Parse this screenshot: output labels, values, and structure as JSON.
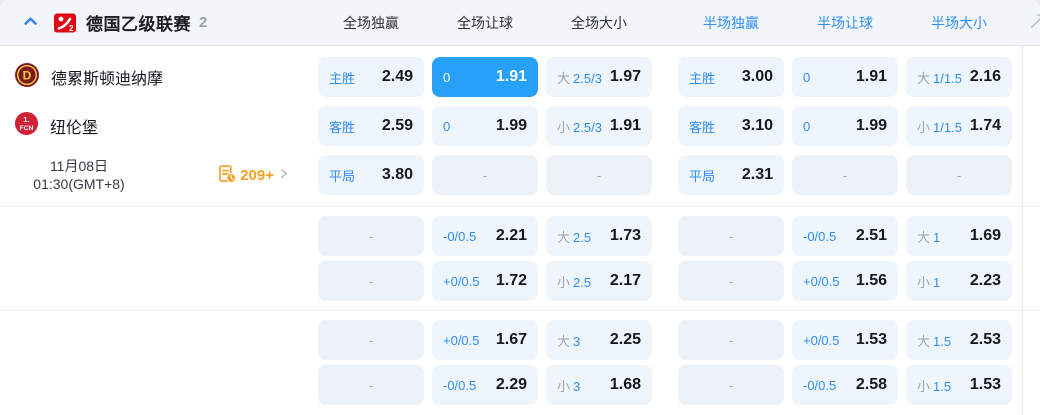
{
  "header": {
    "collapse_icon": "chevron-up-icon",
    "league_icon": "bundesliga-2-logo",
    "league": "德国乙级联赛",
    "count": "2",
    "columns": [
      {
        "label": "全场独赢",
        "active": false
      },
      {
        "label": "全场让球",
        "active": false
      },
      {
        "label": "全场大小",
        "active": false
      },
      {
        "label": "半场独赢",
        "active": true
      },
      {
        "label": "半场让球",
        "active": true
      },
      {
        "label": "半场大小",
        "active": true
      }
    ]
  },
  "match": {
    "home_team": "德累斯顿迪纳摩",
    "home_logo_icon": "dynamo-dresden-crest",
    "away_team": "纽伦堡",
    "away_logo_icon": "nuernberg-crest",
    "date": "11月08日",
    "time": "01:30(GMT+8)",
    "more_markets_count": "209+",
    "more_markets_icon": "list-clock-icon",
    "more_arrow_icon": "chevron-right-icon"
  },
  "empty_placeholder": "-",
  "colors": {
    "accent_blue": "#2f8ef4",
    "selected_cell_bg": "#27a0f7",
    "cell_bg": "#eef5fc",
    "orange": "#f6a021"
  },
  "odds_groups": [
    {
      "rows": [
        [
          {
            "t": "win",
            "label": "主胜",
            "value": "2.49"
          },
          {
            "t": "hcp",
            "label": "0",
            "value": "1.91",
            "selected": true
          },
          {
            "t": "ou",
            "side": "大",
            "line": "2.5/3",
            "value": "1.97"
          },
          {
            "t": "win",
            "label": "主胜",
            "value": "3.00"
          },
          {
            "t": "hcp",
            "label": "0",
            "value": "1.91"
          },
          {
            "t": "ou",
            "side": "大",
            "line": "1/1.5",
            "value": "2.16"
          }
        ],
        [
          {
            "t": "win",
            "label": "客胜",
            "value": "2.59"
          },
          {
            "t": "hcp",
            "label": "0",
            "value": "1.99"
          },
          {
            "t": "ou",
            "side": "小",
            "line": "2.5/3",
            "value": "1.91"
          },
          {
            "t": "win",
            "label": "客胜",
            "value": "3.10"
          },
          {
            "t": "hcp",
            "label": "0",
            "value": "1.99"
          },
          {
            "t": "ou",
            "side": "小",
            "line": "1/1.5",
            "value": "1.74"
          }
        ],
        [
          {
            "t": "win",
            "label": "平局",
            "value": "3.80"
          },
          {
            "t": "empty"
          },
          {
            "t": "empty"
          },
          {
            "t": "win",
            "label": "平局",
            "value": "2.31"
          },
          {
            "t": "empty"
          },
          {
            "t": "empty"
          }
        ]
      ]
    },
    {
      "rows": [
        [
          {
            "t": "empty"
          },
          {
            "t": "hcp",
            "label": "-0/0.5",
            "value": "2.21"
          },
          {
            "t": "ou",
            "side": "大",
            "line": "2.5",
            "value": "1.73"
          },
          {
            "t": "empty"
          },
          {
            "t": "hcp",
            "label": "-0/0.5",
            "value": "2.51"
          },
          {
            "t": "ou",
            "side": "大",
            "line": "1",
            "value": "1.69"
          }
        ],
        [
          {
            "t": "empty"
          },
          {
            "t": "hcp",
            "label": "+0/0.5",
            "value": "1.72"
          },
          {
            "t": "ou",
            "side": "小",
            "line": "2.5",
            "value": "2.17"
          },
          {
            "t": "empty"
          },
          {
            "t": "hcp",
            "label": "+0/0.5",
            "value": "1.56"
          },
          {
            "t": "ou",
            "side": "小",
            "line": "1",
            "value": "2.23"
          }
        ]
      ]
    },
    {
      "rows": [
        [
          {
            "t": "empty"
          },
          {
            "t": "hcp",
            "label": "+0/0.5",
            "value": "1.67"
          },
          {
            "t": "ou",
            "side": "大",
            "line": "3",
            "value": "2.25"
          },
          {
            "t": "empty"
          },
          {
            "t": "hcp",
            "label": "+0/0.5",
            "value": "1.53"
          },
          {
            "t": "ou",
            "side": "大",
            "line": "1.5",
            "value": "2.53"
          }
        ],
        [
          {
            "t": "empty"
          },
          {
            "t": "hcp",
            "label": "-0/0.5",
            "value": "2.29"
          },
          {
            "t": "ou",
            "side": "小",
            "line": "3",
            "value": "1.68"
          },
          {
            "t": "empty"
          },
          {
            "t": "hcp",
            "label": "-0/0.5",
            "value": "2.58"
          },
          {
            "t": "ou",
            "side": "小",
            "line": "1.5",
            "value": "1.53"
          }
        ]
      ]
    }
  ]
}
